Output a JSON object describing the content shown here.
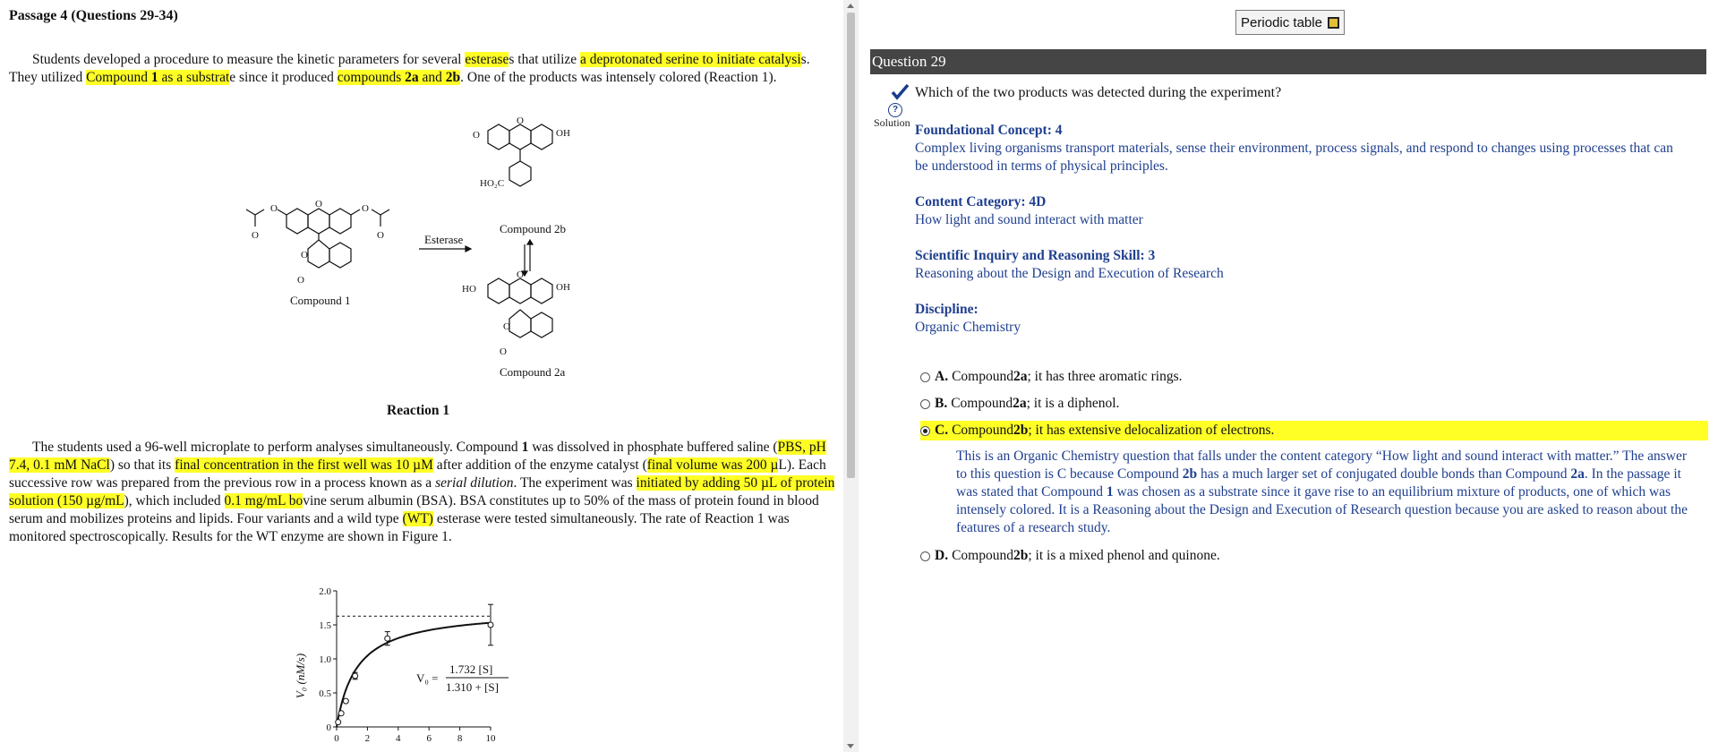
{
  "passage": {
    "title": "Passage 4 (Questions 29-34)",
    "p1": {
      "t1": "Students developed a procedure to measure the kinetic parameters for several ",
      "h1": "esterase",
      "t2": "s that utilize ",
      "h2": "a deprotonated serine to initiate catalysi",
      "t3": "s. They utilized ",
      "h3a": "Compound ",
      "h3b": "1",
      "h3c": " as a substrat",
      "t4": "e since it produced ",
      "h4a": "compounds ",
      "h4b": "2a",
      "h4c": " and ",
      "h4d": "2b",
      "t5": ". One of the products was intensely colored (Reaction 1)."
    },
    "reaction": {
      "caption": "Reaction 1",
      "compound1": "Compound 1",
      "compound2a": "Compound 2a",
      "compound2b": "Compound 2b",
      "enzyme": "Esterase"
    },
    "p2": {
      "t1": "The students used a 96-well microplate to perform analyses simultaneously. Compound ",
      "b1": "1",
      "t2": " was dissolved in phosphate buffered saline (",
      "h1": "PBS, pH 7.4, 0.1 mM NaCl",
      "t3": ") so that its ",
      "h2": "final concentration in the first well was 10 µM",
      "t4": " after addition of the enzyme catalyst (",
      "h3": "final volume was 200 µ",
      "t5": "L). Each successive row was prepared from the previous row in a process known as a ",
      "i1": "serial dilution",
      "t6": ". The experiment was ",
      "h4": "initiated by adding 50 µL of protein solution (150 µg/mL",
      "t7": "), which included ",
      "h5": "0.1 mg/mL bo",
      "t8": "vine serum albumin (BSA). BSA constitutes up to 50% of the mass of protein found in blood serum and mobilizes proteins and lipids. Four variants and a wild type ",
      "h6": "(WT)",
      "t9": " esterase were tested simultaneously. The rate of Reaction 1 was monitored spectroscopically. Results for the WT enzyme are shown in Figure 1."
    }
  },
  "chart_data": {
    "type": "scatter",
    "ylabel": "V₀ (nM/s)",
    "xlabel": "",
    "x_ticks": [
      "0",
      "2",
      "4",
      "6",
      "8",
      "10"
    ],
    "y_ticks": [
      "0",
      "0.5",
      "1.0",
      "1.5",
      "2.0"
    ],
    "xlim": [
      0,
      10
    ],
    "ylim": [
      0,
      2.0
    ],
    "points": [
      {
        "x": 0.1,
        "y": 0.07
      },
      {
        "x": 0.3,
        "y": 0.2
      },
      {
        "x": 0.6,
        "y": 0.38
      },
      {
        "x": 1.2,
        "y": 0.75
      },
      {
        "x": 3.3,
        "y": 1.3
      },
      {
        "x": 10.0,
        "y": 1.5
      }
    ],
    "errors": [
      0,
      0,
      0,
      0.05,
      0.1,
      0.3
    ],
    "vmax": 1.732,
    "km": 1.31,
    "equation": {
      "lhs": "V₀ =",
      "num": "1.732 [S]",
      "den": "1.310 + [S]"
    }
  },
  "right": {
    "periodic_button": "Periodic table",
    "question_header": "Question 29",
    "question_text": "Which of the two products was detected during the experiment?",
    "solution_label": "Solution",
    "solution_icon": "?",
    "foundational": {
      "head": "Foundational Concept: 4",
      "body": "Complex living organisms transport materials, sense their environment, process signals, and respond to changes using processes that can be understood in terms of physical principles."
    },
    "content": {
      "head": "Content Category: 4D",
      "body": "How light and sound interact with matter"
    },
    "skill": {
      "head": "Scientific Inquiry and Reasoning Skill: 3",
      "body": "Reasoning about the Design and Execution of Research"
    },
    "discipline": {
      "head": "Discipline:",
      "body": "Organic Chemistry"
    },
    "options": [
      {
        "letter": "A.",
        "pre": " Compound ",
        "b": "2a",
        "post": "; it has three aromatic rings."
      },
      {
        "letter": "B.",
        "pre": " Compound ",
        "b": "2a",
        "post": "; it is a diphenol."
      },
      {
        "letter": "C.",
        "pre": " Compound ",
        "b": "2b",
        "post": "; it has extensive delocalization of electrons."
      },
      {
        "letter": "D.",
        "pre": " Compound ",
        "b": "2b",
        "post": "; it is a mixed phenol and quinone."
      }
    ],
    "explanation": {
      "t1": "This is an Organic Chemistry question that falls under the content category “How light and sound interact with matter.” The answer to this question is C because Compound ",
      "b1": "2b",
      "t2": " has a much larger set of conjugated double bonds than Compound ",
      "b2": "2a",
      "t3": ". In the passage it was stated that Compound ",
      "b3": "1",
      "t4": " was chosen as a substrate since it gave rise to an equilibrium mixture of products, one of which was intensely colored. It is a Reasoning about the Design and Execution of Research question because you are asked to reason about the features of a research study."
    }
  }
}
